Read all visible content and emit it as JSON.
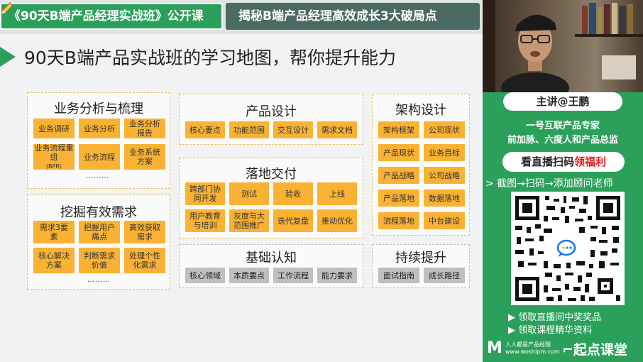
{
  "header": {
    "course_tab": "《90天B端产品经理实战班》公开课",
    "topic_tab": "揭秘B端产品经理高效成长3大破局点"
  },
  "page_title": "90天B端产品实战班的学习地图，帮你提升能力",
  "panels": {
    "biz": {
      "title": "业务分析与梳理",
      "chips": [
        "业务调研",
        "业务分析",
        "业务分析报告",
        "业务流程重组",
        "(BPR)",
        "业务流程",
        "业务系统方案"
      ],
      "more": "………"
    },
    "needs": {
      "title": "挖掘有效需求",
      "chips": [
        "需求3要素",
        "把握用户痛点",
        "高效获取需求",
        "核心解决方案",
        "判断需求价值",
        "处理个性化需求"
      ],
      "more": "………"
    },
    "design": {
      "title": "产品设计",
      "chips": [
        "核心要点",
        "功能范围",
        "交互设计",
        "需求文档"
      ]
    },
    "delivery": {
      "title": "落地交付",
      "chips": [
        "跨部门协同开发",
        "测试",
        "验收",
        "上线",
        "用户教育与培训",
        "灰度与大范围推广",
        "迭代复盘",
        "推动优化"
      ]
    },
    "basics": {
      "title": "基础认知",
      "chips": [
        "核心领域",
        "本质要点",
        "工作流程",
        "能力要求"
      ]
    },
    "arch": {
      "title": "架构设计",
      "chips": [
        "架构框架",
        "公司现状",
        "产品现状",
        "业务目标",
        "产品战略",
        "公司战略",
        "产品落地",
        "数据落地",
        "流程落地",
        "中台建设"
      ]
    },
    "growth": {
      "title": "持续提升",
      "chips": [
        "面试指南",
        "成长路径"
      ]
    }
  },
  "sidebar": {
    "presenter": "主讲@王鹏",
    "desc_line1": "一号互联产品专家",
    "desc_line2": "前加脉、六度人和产品总监",
    "scan_prefix": "看直播扫码",
    "scan_highlight": "领福利",
    "steps": "> 截图→扫码→添加顾问老师",
    "benefits": [
      "▶ 领取直播间中奖奖品",
      "▶ 领取课程精华资料"
    ],
    "logo_left_line1": "人人都是产品经理",
    "logo_left_line2": "www.woshipm.com",
    "logo_right": "起点课堂"
  },
  "colors": {
    "brand_green": "#2ba05a",
    "chip_orange": "#f9b233",
    "chip_gray": "#bfbfbf",
    "highlight_red": "#e02020"
  }
}
